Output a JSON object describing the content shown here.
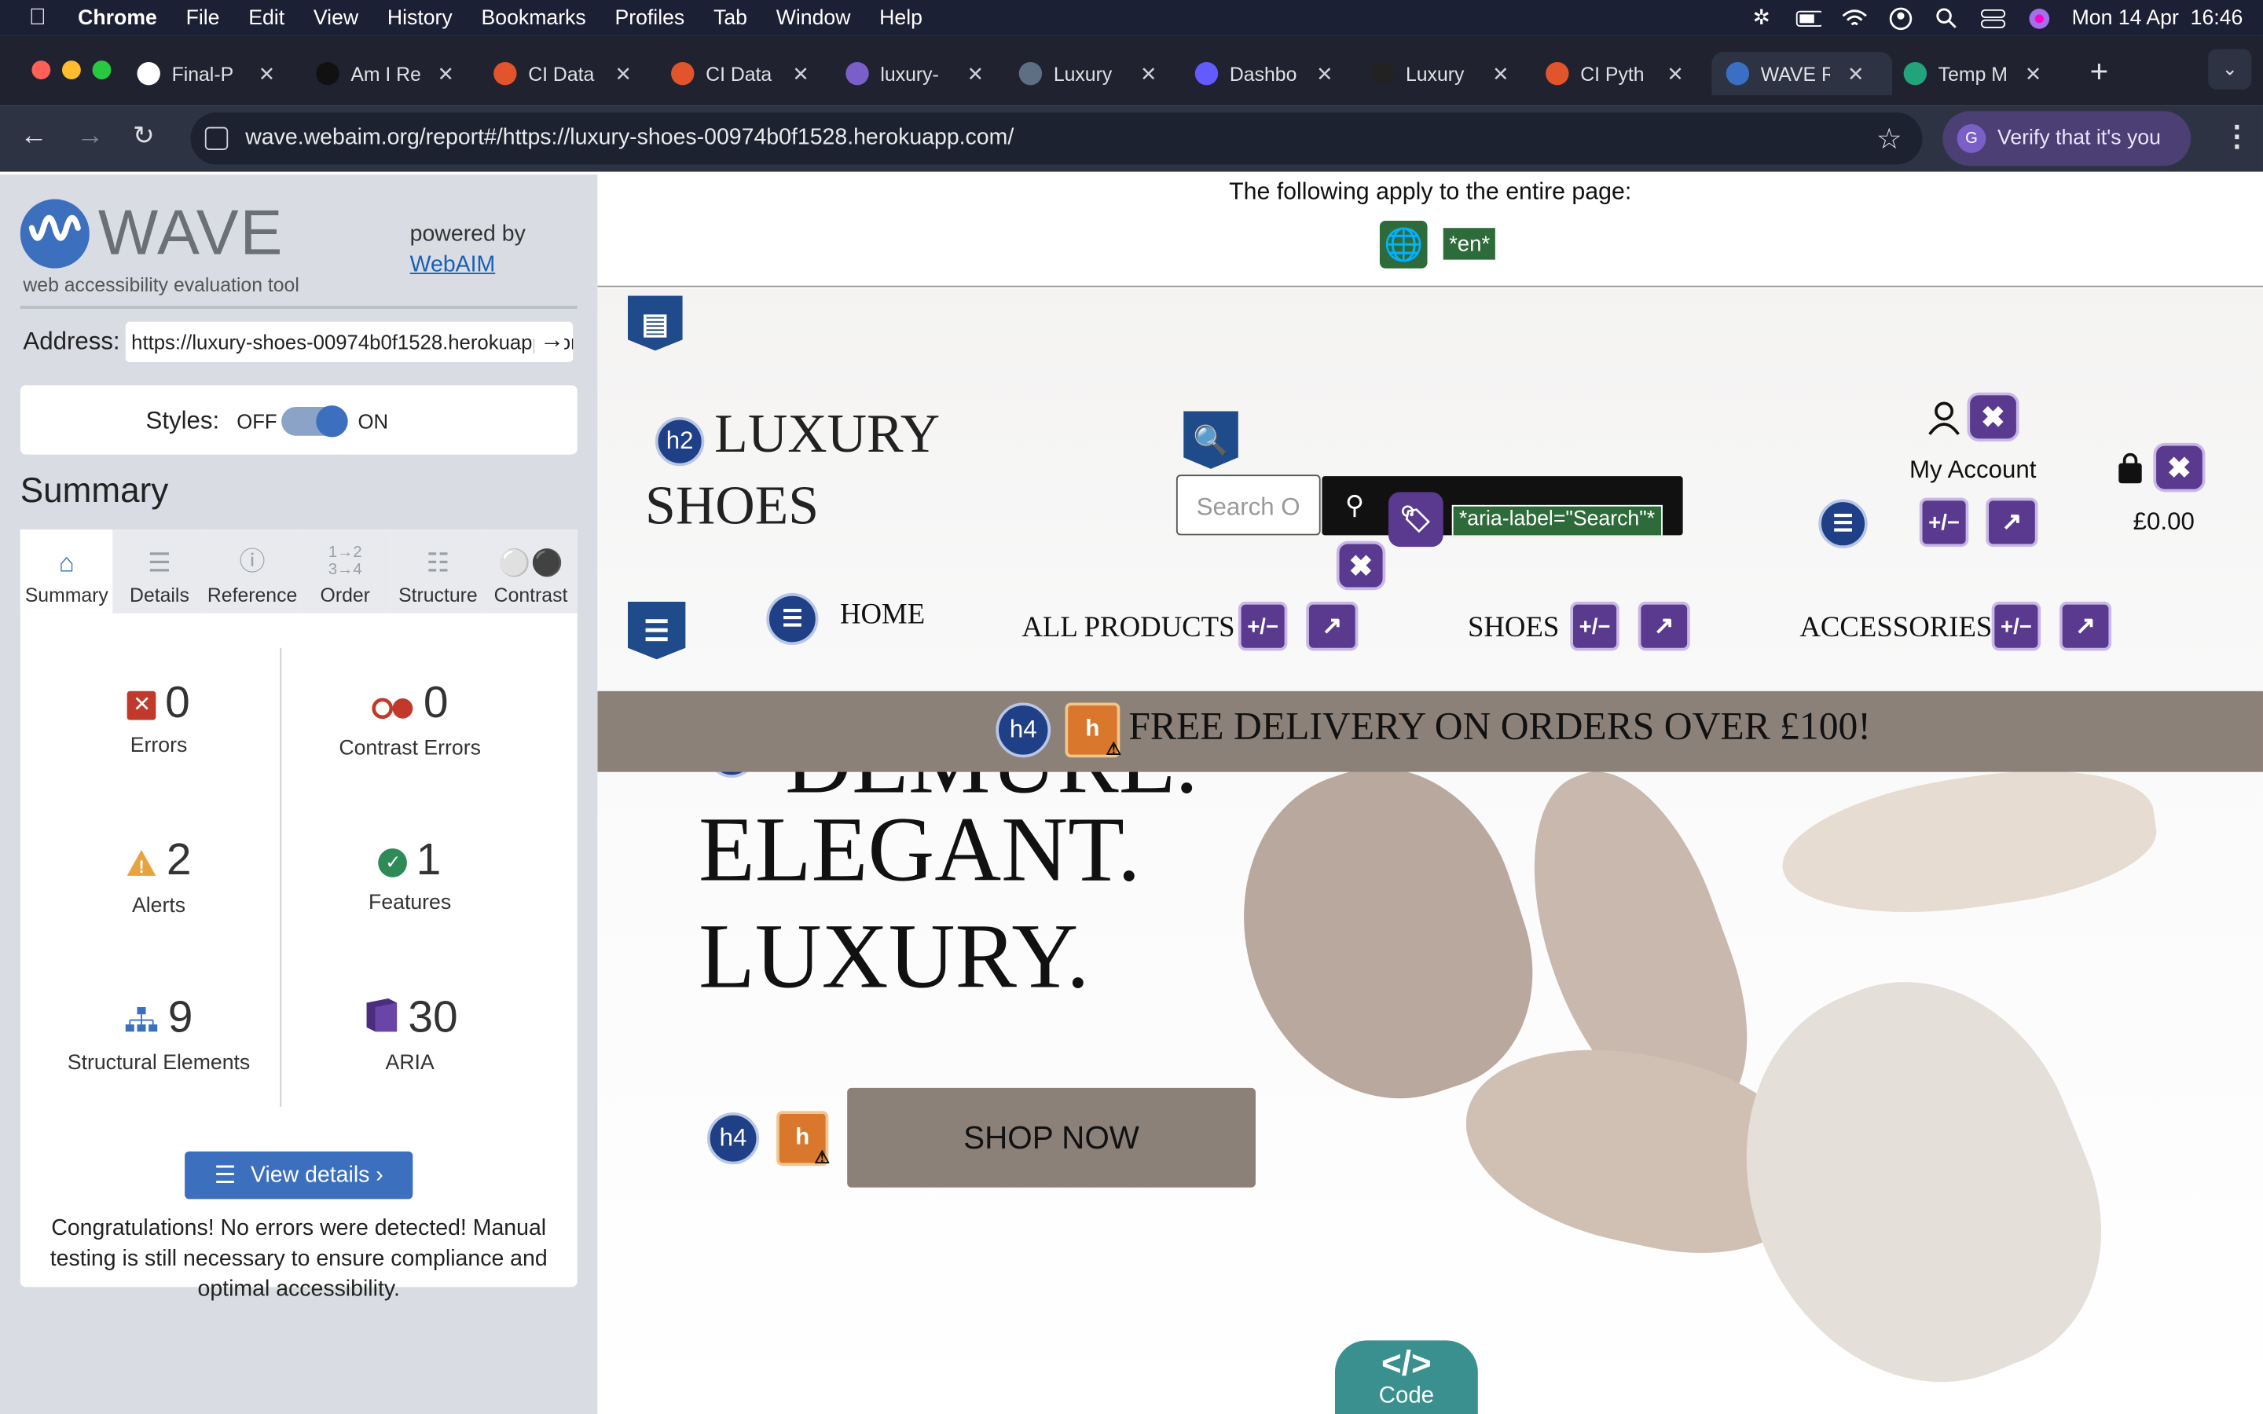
{
  "menubar": {
    "app": "Chrome",
    "items": [
      "File",
      "Edit",
      "View",
      "History",
      "Bookmarks",
      "Profiles",
      "Tab",
      "Window",
      "Help"
    ],
    "clock": "Mon 14 Apr  16:46"
  },
  "tabs": [
    {
      "title": "Final-P",
      "color": "#ffffff"
    },
    {
      "title": "Am I Re",
      "color": "#111111"
    },
    {
      "title": "CI Data",
      "color": "#e2542b"
    },
    {
      "title": "CI Data",
      "color": "#e2542b"
    },
    {
      "title": "luxury-",
      "color": "#7b5fc9"
    },
    {
      "title": "Luxury",
      "color": "#5f6f83"
    },
    {
      "title": "Dashbo",
      "color": "#635bff"
    },
    {
      "title": "Luxury",
      "color": "#222222"
    },
    {
      "title": "CI Pyth",
      "color": "#e2542b"
    },
    {
      "title": "WAVE R",
      "color": "#3b6fc4"
    },
    {
      "title": "Temp M",
      "color": "#22a37a"
    }
  ],
  "toolbar": {
    "url": "wave.webaim.org/report#/https://luxury-shoes-00974b0f1528.herokuapp.com/",
    "verify_label": "Verify that it's you",
    "profile_initial": "G"
  },
  "wave": {
    "logo_text": "WAVE",
    "tagline": "web accessibility evaluation tool",
    "powered_by": "powered by",
    "webaim": "WebAIM",
    "address_label": "Address:",
    "address_value": "https://luxury-shoes-00974b0f1528.herokuapp.com/",
    "styles_label": "Styles:",
    "styles_off": "OFF",
    "styles_on": "ON",
    "summary_heading": "Summary",
    "tabs": [
      "Summary",
      "Details",
      "Reference",
      "Order",
      "Structure",
      "Contrast"
    ],
    "stats": {
      "errors": {
        "value": "0",
        "label": "Errors"
      },
      "contrast": {
        "value": "0",
        "label": "Contrast Errors"
      },
      "alerts": {
        "value": "2",
        "label": "Alerts"
      },
      "features": {
        "value": "1",
        "label": "Features"
      },
      "structural": {
        "value": "9",
        "label": "Structural Elements"
      },
      "aria": {
        "value": "30",
        "label": "ARIA"
      }
    },
    "view_details": "View details ›",
    "congrats": "Congratulations! No errors were detected! Manual testing is still necessary to ensure compliance and optimal accessibility."
  },
  "page": {
    "banner_text": "The following apply to the entire page:",
    "lang_badge": "*en*",
    "brand_line1": "LUXURY",
    "brand_line2": "SHOES",
    "search_placeholder": "Search O",
    "aria_label_tag": "*aria-label=\"Search\"*",
    "my_account": "My Account",
    "cart_total": "£0.00",
    "nav": [
      "HOME",
      "ALL PRODUCTS",
      "SHOES",
      "ACCESSORIES"
    ],
    "delivery": "FREE DELIVERY ON ORDERS OVER £100!",
    "hero_line1": "DEMURE.",
    "hero_line2": "ELEGANT.",
    "hero_line3": "LUXURY.",
    "shop_now": "SHOP NOW",
    "code_label": "Code",
    "h2": "h2",
    "h4": "h4"
  }
}
